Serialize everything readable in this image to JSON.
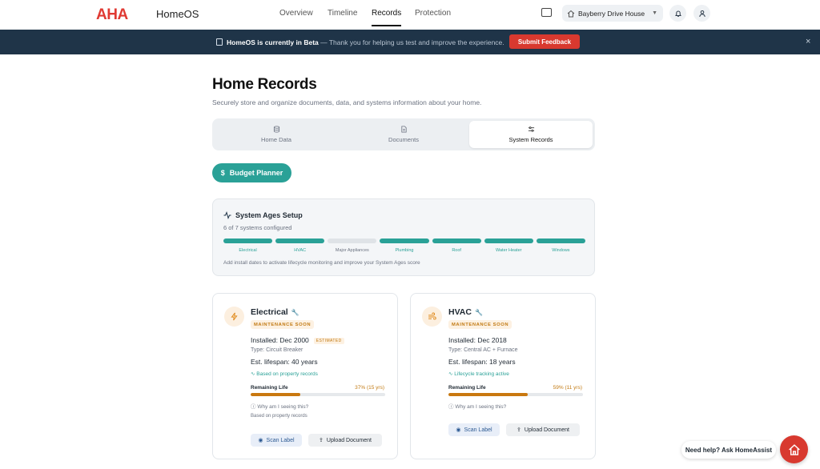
{
  "nav": {
    "logo": "AHA",
    "product": "HomeOS",
    "links": [
      {
        "label": "Overview",
        "active": false
      },
      {
        "label": "Timeline",
        "active": false
      },
      {
        "label": "Records",
        "active": true
      },
      {
        "label": "Protection",
        "active": false
      }
    ],
    "house": "Bayberry Drive House"
  },
  "banner": {
    "bold": "HomeOS is currently in Beta",
    "rest": " — Thank you for helping us test and improve the experience.",
    "button": "Submit Feedback",
    "close": "×"
  },
  "header": {
    "title": "Home Records",
    "subtitle": "Securely store and organize documents, data, and systems information about your home."
  },
  "tabs": [
    {
      "label": "Home Data",
      "active": false
    },
    {
      "label": "Documents",
      "active": false
    },
    {
      "label": "System Records",
      "active": true
    }
  ],
  "budget": {
    "label": "Budget Planner"
  },
  "ages": {
    "title": "System Ages Setup",
    "count": "6 of 7 systems configured",
    "segments": [
      {
        "label": "Electrical",
        "configured": true
      },
      {
        "label": "HVAC",
        "configured": true
      },
      {
        "label": "Major Appliances",
        "configured": false
      },
      {
        "label": "Plumbing",
        "configured": true
      },
      {
        "label": "Roof",
        "configured": true
      },
      {
        "label": "Water Heater",
        "configured": true
      },
      {
        "label": "Windows",
        "configured": true
      }
    ],
    "note": "Add install dates to activate lifecycle monitoring and improve your System Ages score"
  },
  "cards": [
    {
      "name": "Electrical",
      "badge": "MAINTENANCE SOON",
      "installed": "Installed: Dec 2000",
      "estimated": "ESTIMATED",
      "type": "Type: Circuit Breaker",
      "lifespan": "Est. lifespan: 40 years",
      "basis": "Based on property records",
      "remaining_label": "Remaining Life",
      "remaining_value": "37% (15 yrs)",
      "remaining_fraction": 0.37,
      "why": "Why am I seeing this?",
      "footnote": "Based on property records",
      "scan": "Scan Label",
      "upload": "Upload Document"
    },
    {
      "name": "HVAC",
      "badge": "MAINTENANCE SOON",
      "installed": "Installed: Dec 2018",
      "type": "Type: Central AC + Furnace",
      "lifespan": "Est. lifespan: 18 years",
      "basis": "Lifecycle tracking active",
      "remaining_label": "Remaining Life",
      "remaining_value": "59% (11 yrs)",
      "remaining_fraction": 0.59,
      "why": "Why am I seeing this?",
      "scan": "Scan Label",
      "upload": "Upload Document"
    }
  ],
  "help": {
    "label": "Need help? Ask HomeAssist"
  },
  "colors": {
    "accent": "#2aa197",
    "brand": "#e03a33",
    "banner": "#1f3448",
    "warning": "#c27a13"
  }
}
